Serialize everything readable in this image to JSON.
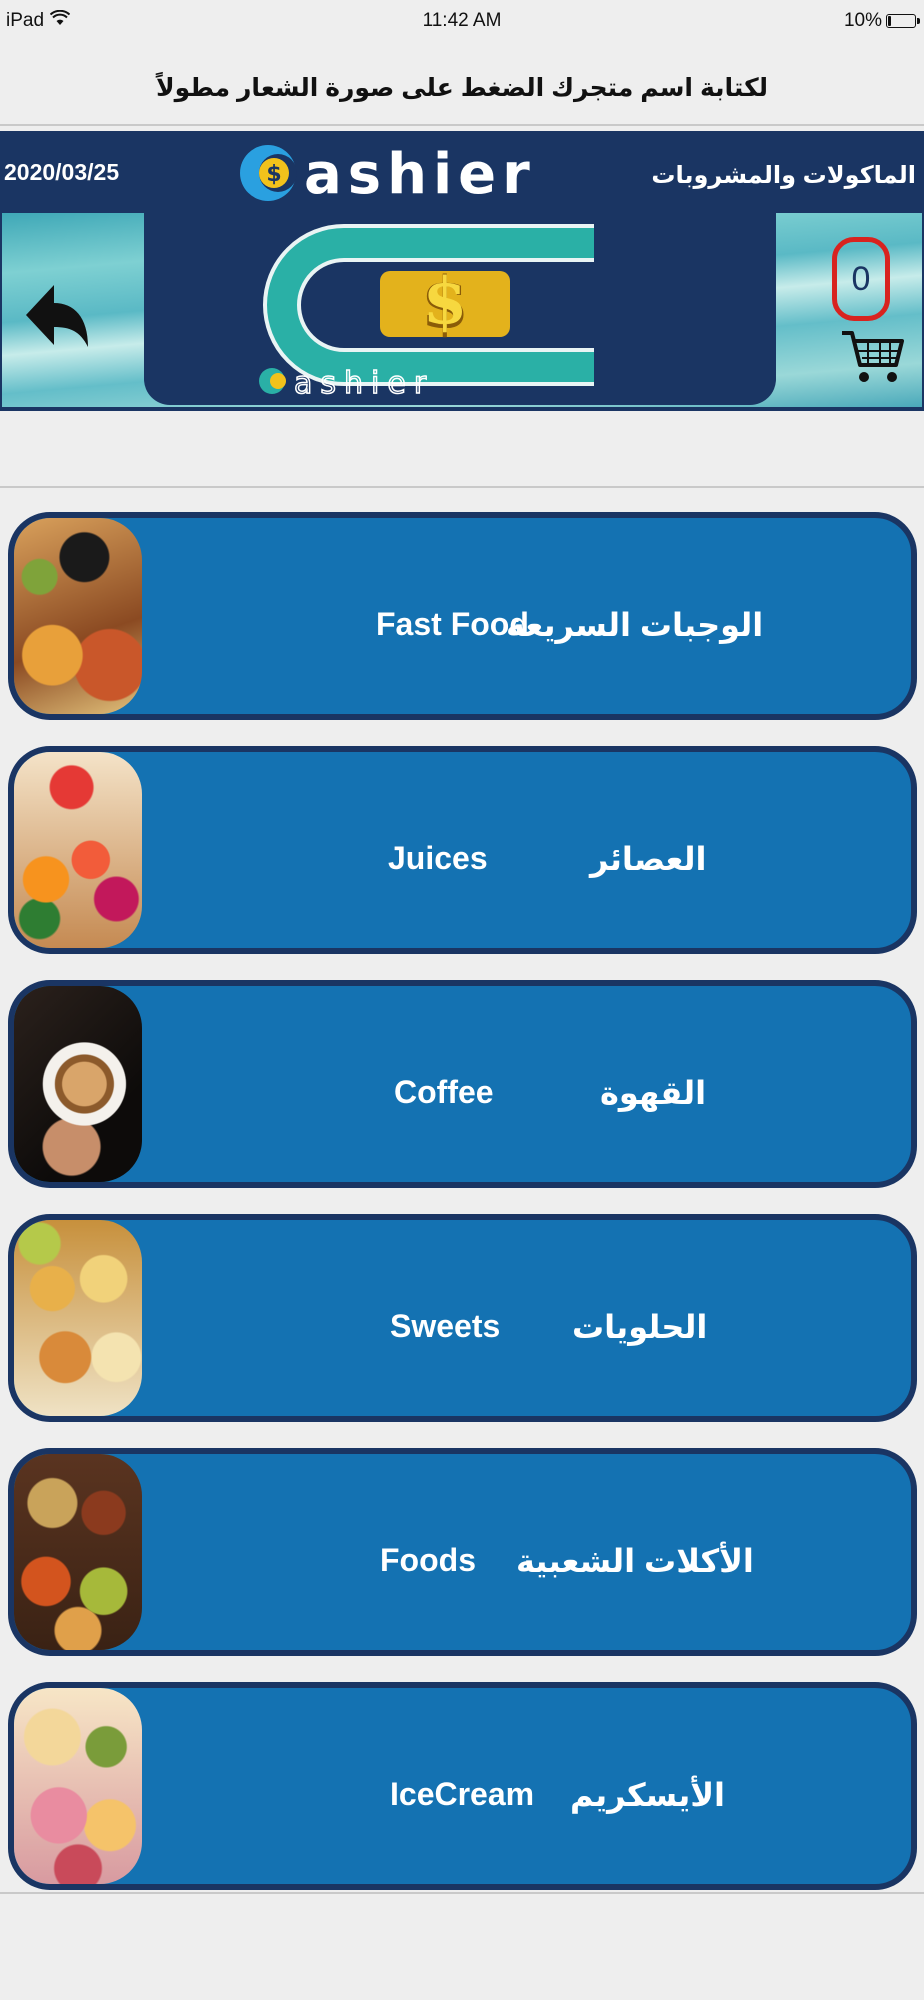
{
  "status_bar": {
    "device": "iPad",
    "time": "11:42 AM",
    "battery": "10%",
    "battery_fraction": 0.1
  },
  "hint": "لكتابة اسم متجرك الضغط على صورة الشعار مطولاً",
  "header": {
    "date": "2020/03/25",
    "app_name": "Cashier",
    "section_title": "الماكولات والمشروبات"
  },
  "cart": {
    "count": "0"
  },
  "categories": [
    {
      "en": "Fast Food",
      "ar": "الوجبات السريعة",
      "image": "fast-food-photo"
    },
    {
      "en": "Juices",
      "ar": "العصائر",
      "image": "juices-photo"
    },
    {
      "en": "Coffee",
      "ar": "القهوة",
      "image": "coffee-photo"
    },
    {
      "en": "Sweets",
      "ar": "الحلويات",
      "image": "sweets-photo"
    },
    {
      "en": "Foods",
      "ar": "الأكلات الشعبية",
      "image": "foods-photo"
    },
    {
      "en": "IceCream",
      "ar": "الأيسكريم",
      "image": "icecream-photo"
    }
  ],
  "colors": {
    "navy": "#1a3563",
    "card_blue": "#1472b2",
    "badge_red": "#d8231f",
    "background": "#eeeeee"
  }
}
